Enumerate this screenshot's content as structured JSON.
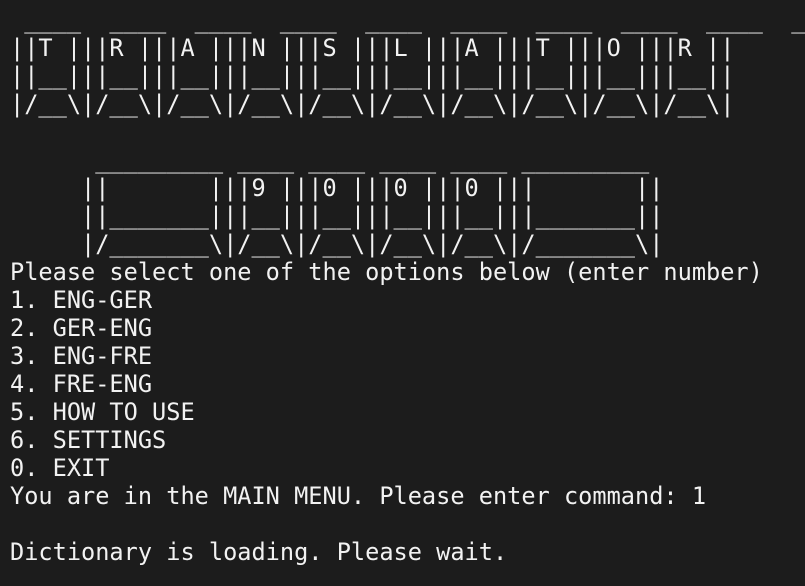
{
  "terminal": {
    "background_color": "#1c1c1c",
    "foreground_color": "#f2f2f2",
    "title_word": "TRANSLATOR",
    "version_word": "9000"
  },
  "banner": {
    "title_ascii": " ____  ____  ____  ____  ____  ____  ____  ____  ____  ____ \n||T |||R |||A |||N |||S |||L |||A |||T |||O |||R ||\n||__|||__|||__|||__|||__|||__|||__|||__|||__|||__||\n|/__\\|/__\\|/__\\|/__\\|/__\\|/__\\|/__\\|/__\\|/__\\|/__\\|",
    "version_ascii": "      _________ ____ ____ ____ ____ _________ \n     ||       |||9 |||0 |||0 |||0 |||       ||\n     ||_______|||__|||__|||__|||__|||_______||\n     |/_______\\|/__\\|/__\\|/__\\|/__\\|/_______\\|"
  },
  "menu": {
    "prompt": "Please select one of the options below (enter number)",
    "options": [
      "1. ENG-GER",
      "2. GER-ENG",
      "3. ENG-FRE",
      "4. FRE-ENG",
      "5. HOW TO USE",
      "6. SETTINGS",
      "0. EXIT"
    ]
  },
  "status": {
    "command_prompt": "You are in the MAIN MENU. Please enter command: ",
    "entered_command": "1",
    "loading_message": "Dictionary is loading. Please wait."
  }
}
